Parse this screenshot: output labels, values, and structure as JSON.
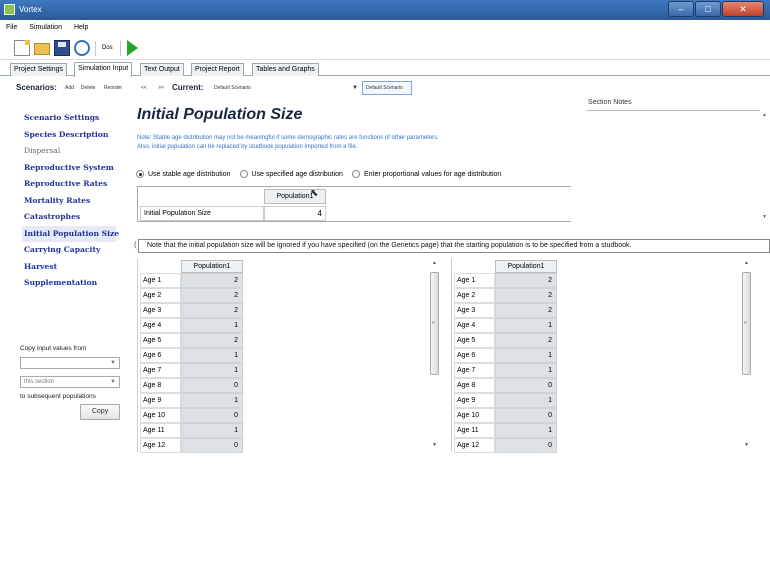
{
  "window": {
    "title": "Vortex",
    "buttons": {
      "minimize": "–",
      "maximize": "□",
      "close": "✕"
    }
  },
  "menu": [
    "File",
    "Simulation",
    "Help"
  ],
  "toolbar": {
    "label": "Dos"
  },
  "tabs": [
    "Project Settings",
    "Simulation Input",
    "Text Output",
    "Project Report",
    "Tables and Graphs"
  ],
  "scenario_bar": {
    "label": "Scenarios:",
    "actions": [
      "Add",
      "Delete",
      "Reorder"
    ],
    "nav": [
      "<<",
      ">>"
    ],
    "current_label": "Current:",
    "current_value": "Default Scenario",
    "selected_box": "Default Scenario"
  },
  "nav": [
    {
      "label": "Scenario Settings",
      "state": "normal"
    },
    {
      "label": "Species Description",
      "state": "normal"
    },
    {
      "label": "Dispersal",
      "state": "disabled"
    },
    {
      "label": "Reproductive System",
      "state": "normal"
    },
    {
      "label": "Reproductive Rates",
      "state": "normal"
    },
    {
      "label": "Mortality Rates",
      "state": "normal"
    },
    {
      "label": "Catastrophes",
      "state": "normal"
    },
    {
      "label": "Initial Population Size",
      "state": "active"
    },
    {
      "label": "Carrying Capacity",
      "state": "normal"
    },
    {
      "label": "Harvest",
      "state": "normal"
    },
    {
      "label": "Supplementation",
      "state": "normal"
    }
  ],
  "copy_panel": {
    "heading": "Copy input values from",
    "from_value": "",
    "section_value": "this section",
    "to_text": "to subsequent populations",
    "button": "Copy"
  },
  "page": {
    "title": "Initial Population Size",
    "note_lines": [
      "Note: Stable age distribution may not be meaningful if some demographic rates are functions of other parameters.",
      "Also, initial population can be replaced by studbook population imported from a file."
    ],
    "radio_options": [
      {
        "label": "Use stable age distribution",
        "checked": true
      },
      {
        "label": "Use specified age distribution",
        "checked": false
      },
      {
        "label": "Enter proportional values for age distribution",
        "checked": false
      }
    ],
    "pop_table": {
      "column": "Population1",
      "row_label": "Initial Population Size",
      "value": "4"
    },
    "warning": "Note that the initial population size will be ignored if you have specified (on the Genetics page) that the starting population is to be specified from a studbook."
  },
  "section_notes": {
    "label": "Section Notes"
  },
  "age_grid_left": {
    "column": "Population1",
    "rows": [
      {
        "age": "Age 1",
        "value": "2"
      },
      {
        "age": "Age 2",
        "value": "2"
      },
      {
        "age": "Age 3",
        "value": "2"
      },
      {
        "age": "Age 4",
        "value": "1"
      },
      {
        "age": "Age 5",
        "value": "2"
      },
      {
        "age": "Age 6",
        "value": "1"
      },
      {
        "age": "Age 7",
        "value": "1"
      },
      {
        "age": "Age 8",
        "value": "0"
      },
      {
        "age": "Age 9",
        "value": "1"
      },
      {
        "age": "Age 10",
        "value": "0"
      },
      {
        "age": "Age 11",
        "value": "1"
      },
      {
        "age": "Age 12",
        "value": "0"
      }
    ]
  },
  "age_grid_right": {
    "column": "Population1",
    "rows": [
      {
        "age": "Age 1",
        "value": "2"
      },
      {
        "age": "Age 2",
        "value": "2"
      },
      {
        "age": "Age 3",
        "value": "2"
      },
      {
        "age": "Age 4",
        "value": "1"
      },
      {
        "age": "Age 5",
        "value": "2"
      },
      {
        "age": "Age 6",
        "value": "1"
      },
      {
        "age": "Age 7",
        "value": "1"
      },
      {
        "age": "Age 8",
        "value": "0"
      },
      {
        "age": "Age 9",
        "value": "1"
      },
      {
        "age": "Age 10",
        "value": "0"
      },
      {
        "age": "Age 11",
        "value": "1"
      },
      {
        "age": "Age 12",
        "value": "0"
      }
    ]
  }
}
